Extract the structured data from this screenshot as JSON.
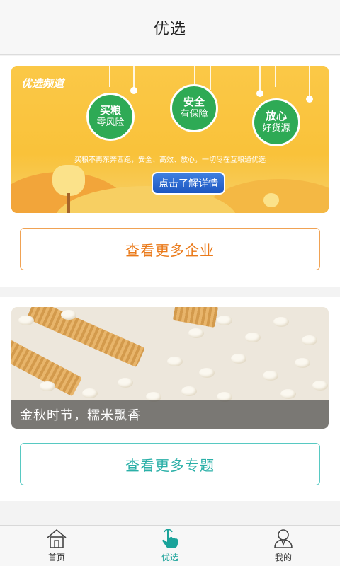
{
  "header": {
    "title": "优选"
  },
  "banner": {
    "tag": "优选频道",
    "badges": [
      {
        "top": "买粮",
        "bottom": "零风险"
      },
      {
        "top": "安全",
        "bottom": "有保障"
      },
      {
        "top": "放心",
        "bottom": "好货源"
      }
    ],
    "slogan": "买粮不再东奔西跑，安全、高效、放心，一切尽在互粮通优选",
    "button_label": "点击了解详情",
    "colors": {
      "background": "#f8c43f",
      "badge": "#2eaa55",
      "button": "#1d56c0"
    }
  },
  "more_companies": {
    "label": "查看更多企业",
    "color": "#ea7a1a"
  },
  "feature": {
    "caption": "金秋时节，糯米飘香"
  },
  "more_topics": {
    "label": "查看更多专题",
    "color": "#2bb0a8"
  },
  "tabbar": {
    "tabs": [
      {
        "label": "首页",
        "icon": "home-icon",
        "active": false
      },
      {
        "label": "优选",
        "icon": "hand-pointer-icon",
        "active": true
      },
      {
        "label": "我的",
        "icon": "user-icon",
        "active": false
      }
    ],
    "active_color": "#1aa39a"
  }
}
